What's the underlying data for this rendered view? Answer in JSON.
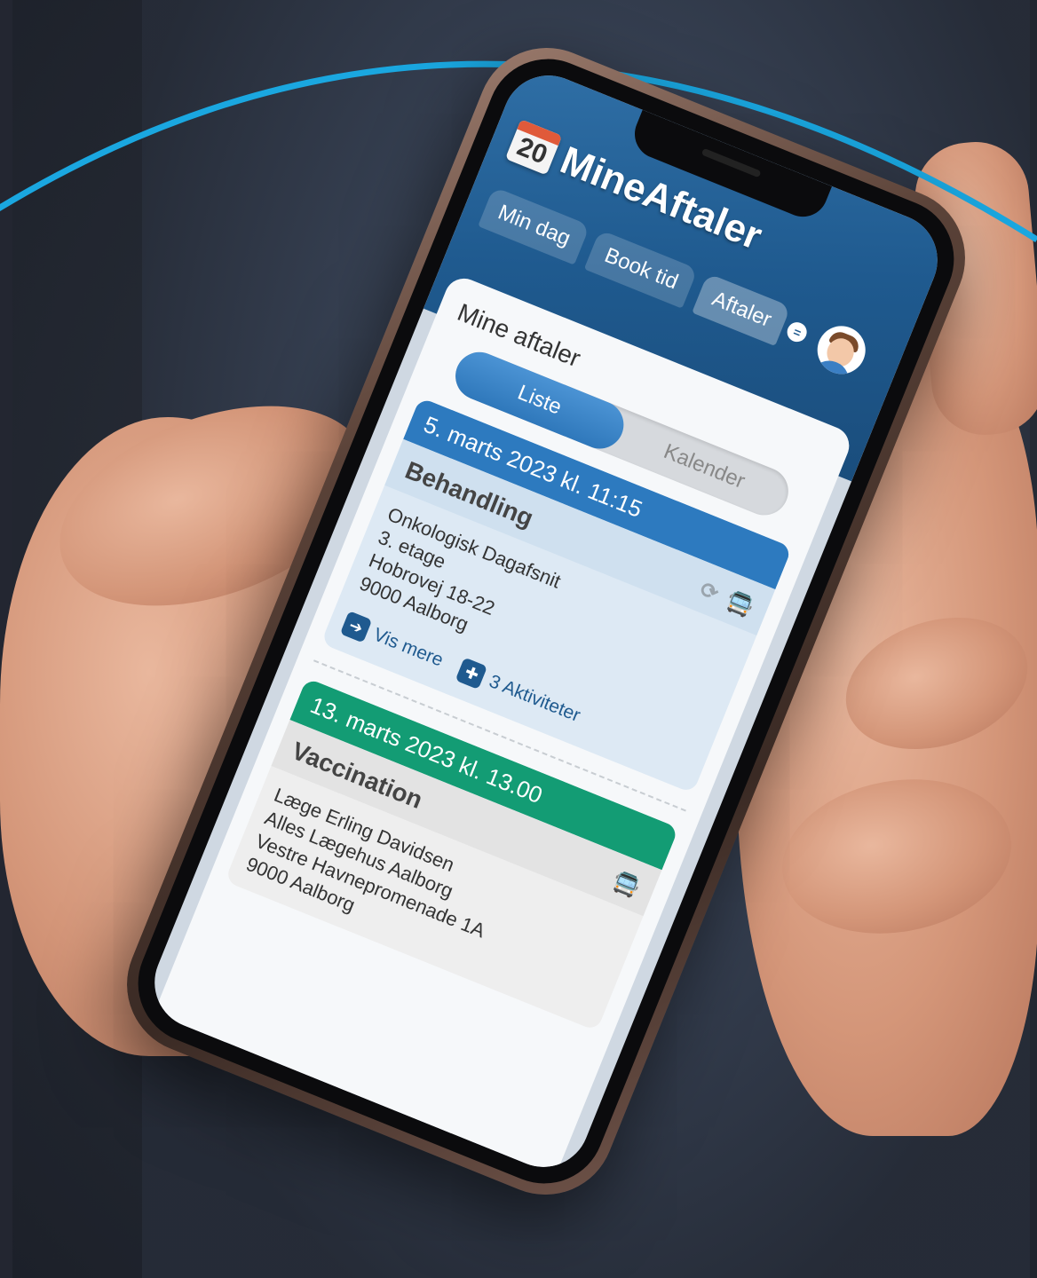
{
  "app": {
    "name": "MineAftaler",
    "calendar_number": "20"
  },
  "nav": {
    "tabs": [
      {
        "label": "Min dag"
      },
      {
        "label": "Book tid"
      },
      {
        "label": "Aftaler"
      }
    ],
    "menu_symbol": "="
  },
  "main": {
    "title": "Mine aftaler",
    "view_toggle": {
      "options": [
        "Liste",
        "Kalender"
      ],
      "selected": "Liste"
    }
  },
  "appointments": [
    {
      "date": "5. marts 2023 kl. 11:15",
      "type": "Behandling",
      "address_lines": [
        "Onkologisk Dagafsnit",
        "3. etage",
        "Hobrovej 18-22",
        "9000 Aalborg"
      ],
      "icons": [
        "sync-icon",
        "transport-icon"
      ],
      "actions": {
        "more": "Vis mere",
        "activities": "3 Aktiviteter"
      },
      "color": "#2d7abf"
    },
    {
      "date": "13. marts 2023 kl. 13.00",
      "type": "Vaccination",
      "address_lines": [
        "Læge Erling Davidsen",
        "Alles Lægehus Aalborg",
        "Vestre Havnepromenade 1A",
        "9000 Aalborg"
      ],
      "icons": [
        "transport-icon"
      ],
      "color": "#139c74"
    }
  ],
  "colors": {
    "header": "#1f5a8f",
    "accent_arc": "#1aa7e0",
    "primary_blue": "#2d7abf",
    "green": "#139c74"
  }
}
